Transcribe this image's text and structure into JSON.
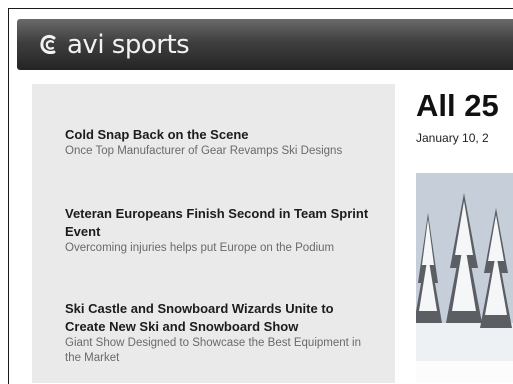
{
  "header": {
    "brand": "avi sports",
    "logo_icon": "swirl-c-logo-icon"
  },
  "sidebar": {
    "items": [
      {
        "title": "Cold Snap Back on the Scene",
        "description": "Once Top Manufacturer of Gear Revamps Ski Designs"
      },
      {
        "title": "Veteran Europeans Finish Second in Team Sprint Event",
        "description": "Overcoming injuries helps put Europe on the Podium"
      },
      {
        "title": "Ski Castle and Snowboard Wizards Unite to Create New Ski and Snowboard Show",
        "description": "Giant Show Designed to Showcase the Best Equipment in the Market"
      }
    ]
  },
  "main": {
    "title": "All 25",
    "date": "January 10, 2",
    "image": "snowy-forest-photo"
  },
  "colors": {
    "header_dark": "#242424",
    "sidebar_bg": "#eaeaea",
    "desc_text": "#6a6a6a"
  }
}
